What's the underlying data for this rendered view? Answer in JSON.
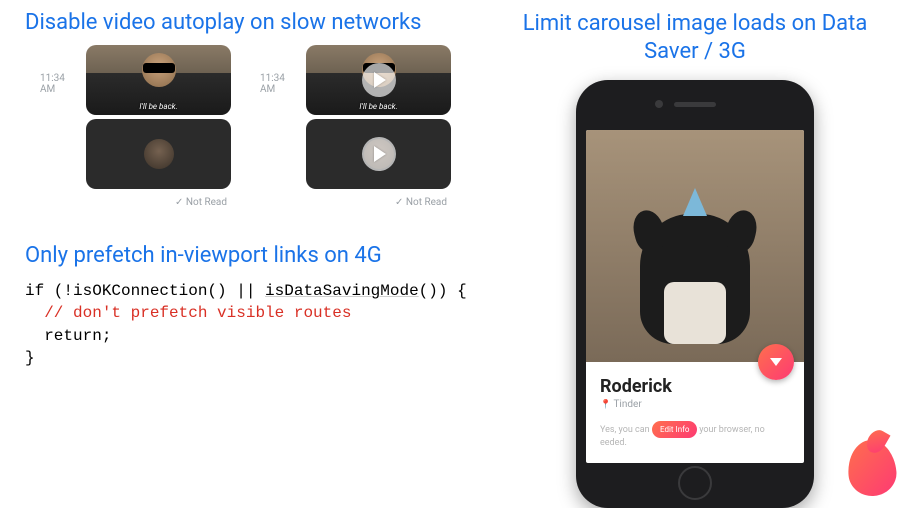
{
  "autoplay": {
    "heading": "Disable video autoplay on slow networks",
    "timestamp": "11:34 AM",
    "caption": "I'll be back.",
    "not_read": "Not Read"
  },
  "prefetch": {
    "heading": "Only prefetch in-viewport links on 4G",
    "code_line1_if": "if",
    "code_line1_body": " (!isOKConnection() || ",
    "code_line1_fn": "isDataSavingMode",
    "code_line1_tail": "()) {",
    "code_comment": "  // don't prefetch visible routes",
    "code_return": "  return;",
    "code_close": "}"
  },
  "carousel": {
    "heading": "Limit carousel image loads on Data Saver / 3G"
  },
  "tinder": {
    "name": "Roderick",
    "subtitle": "Tinder",
    "prompt_left": "Yes, you can",
    "prompt_right": "in your browser, no",
    "prompt_tail": "eeded.",
    "edit": "Edit Info"
  }
}
